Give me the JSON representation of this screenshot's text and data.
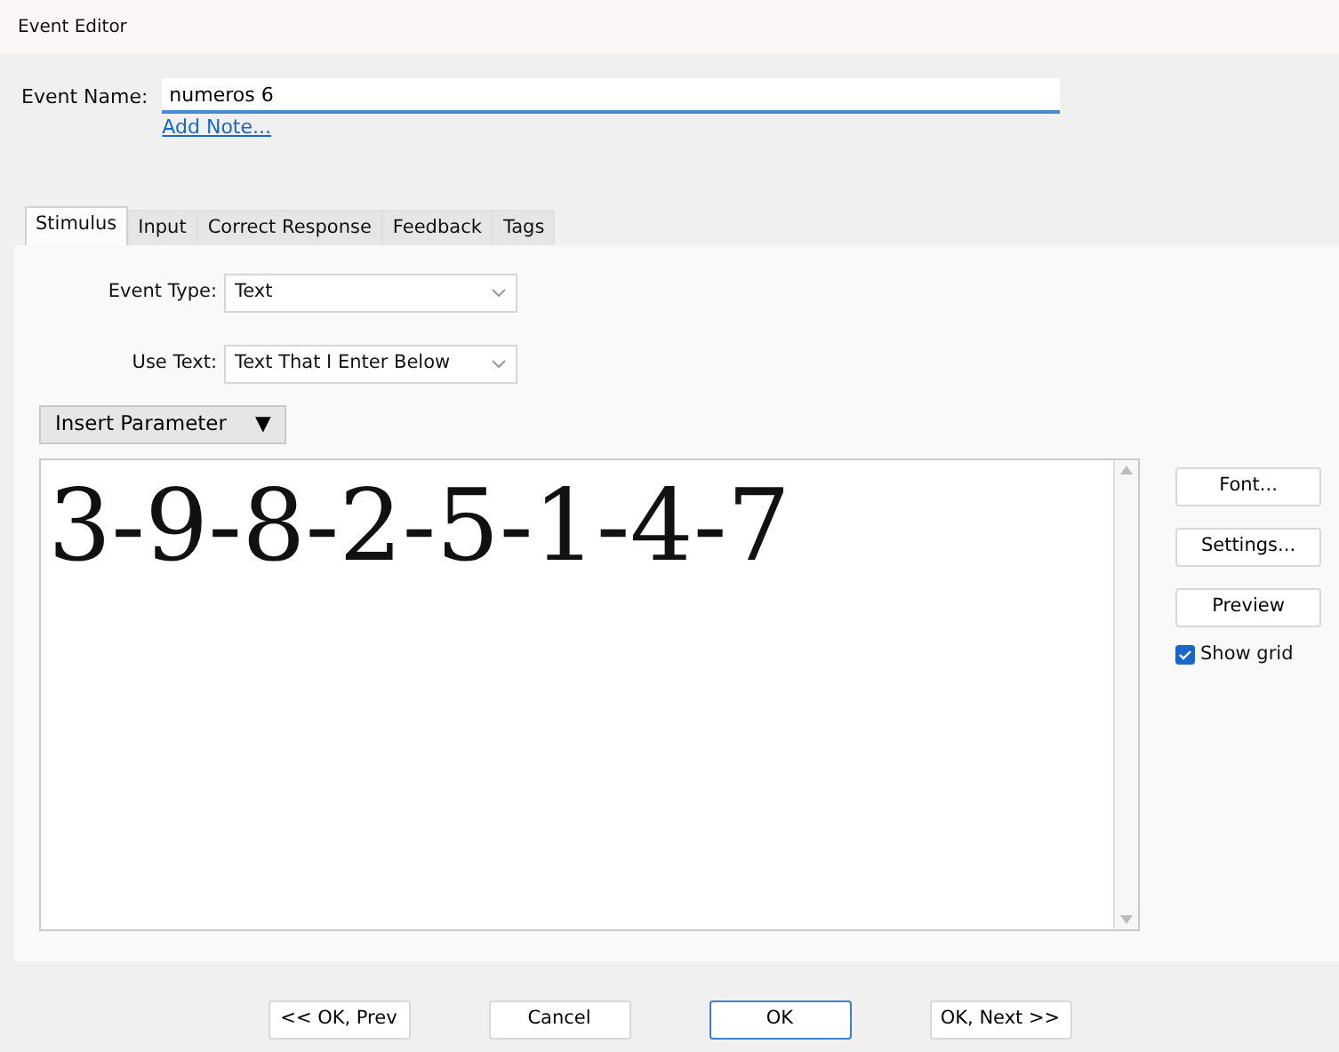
{
  "window": {
    "title": "Event Editor"
  },
  "event_name": {
    "label": "Event Name:",
    "value": "numeros 6",
    "link": "Add Note..."
  },
  "tabs": [
    {
      "label": "Stimulus",
      "selected": true
    },
    {
      "label": "Input",
      "selected": false
    },
    {
      "label": "Correct Response",
      "selected": false
    },
    {
      "label": "Feedback",
      "selected": false
    },
    {
      "label": "Tags",
      "selected": false
    }
  ],
  "fields": [
    {
      "label": "Event Type:",
      "value": "Text"
    },
    {
      "label": "Use Text:",
      "value": "Text That I Enter Below"
    }
  ],
  "insert_button": {
    "label": "Insert Parameter",
    "arrow": "▼"
  },
  "stimulus_text": "3-9-8-2-5-1-4-7",
  "side_buttons": [
    "Font...",
    "Settings...",
    "Preview"
  ],
  "show_grid": {
    "label": "Show grid",
    "checked": true
  },
  "footer_buttons": [
    {
      "label": "<< OK, Prev",
      "default": false
    },
    {
      "label": "Cancel",
      "default": false
    },
    {
      "label": "OK",
      "default": true
    },
    {
      "label": "OK, Next >>",
      "default": false
    }
  ]
}
